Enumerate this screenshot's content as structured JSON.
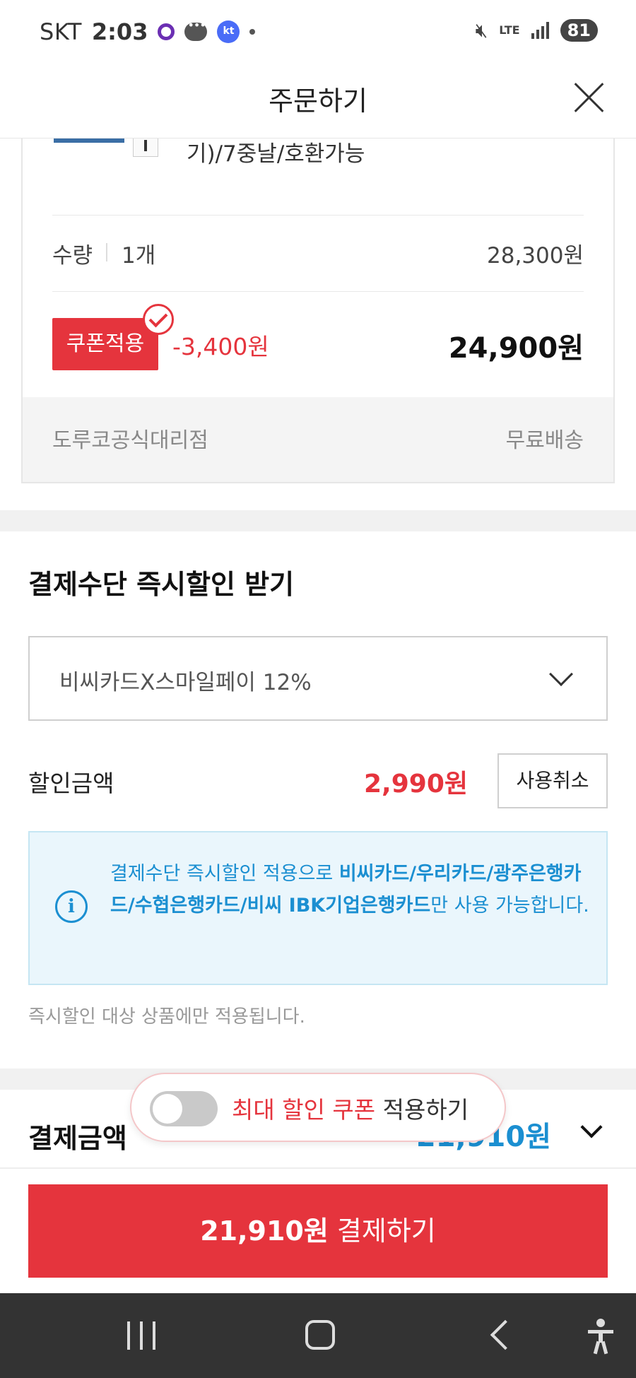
{
  "status_bar": {
    "carrier": "SKT",
    "time": "2:03",
    "kt_badge": "kt",
    "network": "LTE",
    "battery": "81"
  },
  "header": {
    "title": "주문하기"
  },
  "product": {
    "name_tail": "기)/7중날/호환가능",
    "quantity_label": "수량",
    "quantity_value": "1개",
    "original_price": "28,300원",
    "coupon_label": "쿠폰적용",
    "coupon_discount": "-3,400원",
    "final_price": "24,900원",
    "seller": "도루코공식대리점",
    "shipping": "무료배송"
  },
  "instant_discount": {
    "title": "결제수단 즉시할인 받기",
    "selected_option": "비씨카드X스마일페이 12%",
    "amount_label": "할인금액",
    "amount_value": "2,990원",
    "cancel_label": "사용취소",
    "info_prefix": "결제수단 즉시할인 적용으로 ",
    "info_cards": "비씨카드/우리카드/광주은행카드/수협은행카드/비씨 IBK기업은행카드",
    "info_suffix": "만 사용 가능합니다.",
    "note": "즉시할인 대상 상품에만 적용됩니다."
  },
  "payment": {
    "title": "결제금액",
    "amount": "21,910원"
  },
  "toast": {
    "highlight": "최대 할인 쿠폰",
    "text": " 적용하기",
    "toggle_on": false
  },
  "pay_button": {
    "amount": "21,910원",
    "label": " 결제하기"
  },
  "colors": {
    "accent_red": "#e5343d",
    "info_blue": "#1b8fd1",
    "info_bg": "#eaf6fc"
  },
  "icons": [
    "close-icon",
    "check-icon",
    "chevron-down-icon",
    "info-icon",
    "toggle-switch",
    "nav-recents-icon",
    "nav-home-icon",
    "nav-back-icon",
    "accessibility-icon"
  ]
}
